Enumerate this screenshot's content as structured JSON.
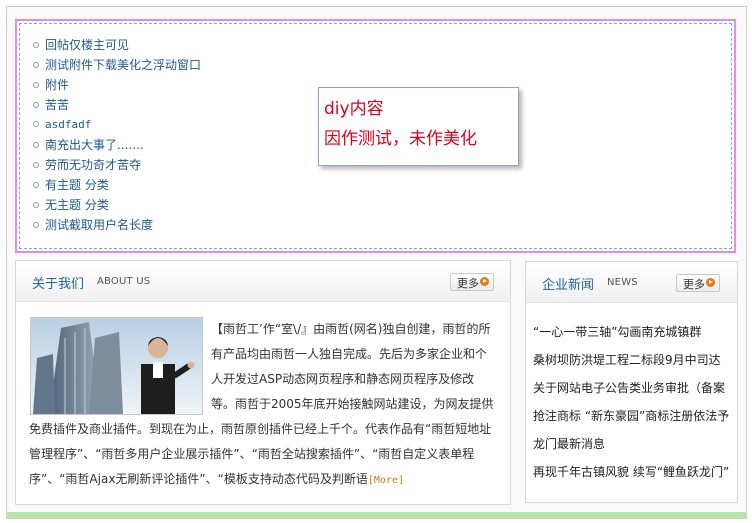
{
  "diy": {
    "threads": [
      "回帖仅楼主可见",
      "测试附件下载美化之浮动窗口",
      "附件",
      "苦苦",
      "asdfadf",
      "南充出大事了.......",
      "劳而无功奇才苦夺",
      "有主题 分类",
      "无主题 分类",
      "测试截取用户名长度"
    ],
    "popup_line1": "diy内容",
    "popup_line2": "因作测试，未作美化"
  },
  "about": {
    "title": "关于我们",
    "subtitle": "ABOUT US",
    "more_label": "更多",
    "text": "【雨哲工’作“室\\/』由雨哲(网名)独自创建，雨哲的所有产品均由雨哲一人独自完成。先后为多家企业和个人开发过ASP动态网页程序和静态网页程序及修改等。雨哲于2005年底开始接触网站建设，为网友提供免费插件及商业插件。到现在为止，雨哲原创插件已经上千个。代表作品有“雨哲短地址管理程序”、“雨哲多用户企业展示插件”、“雨哲全站搜索插件”、“雨哲自定义表单程序”、“雨哲Ajax无刷新评论插件”、“模板支持动态代码及判断语",
    "more_link": "[More]"
  },
  "news": {
    "title": "企业新闻",
    "subtitle": "NEWS",
    "more_label": "更多",
    "items": [
      "“一心一带三轴”勾画南充城镇群",
      "桑树坝防洪堤工程二标段9月中司达",
      "关于网站电子公告类业务审批（备案",
      "抢注商标 “新东豪园”商标注册依法予",
      "龙门最新消息",
      "再现千年古镇风貌 续写“鲤鱼跃龙门”"
    ]
  },
  "colors": {
    "diy_border": "#e18ce8",
    "title_blue": "#1f64a5",
    "link_blue": "#1f5a8c",
    "popup_red": "#e0001b",
    "more_orange": "#e87813"
  }
}
